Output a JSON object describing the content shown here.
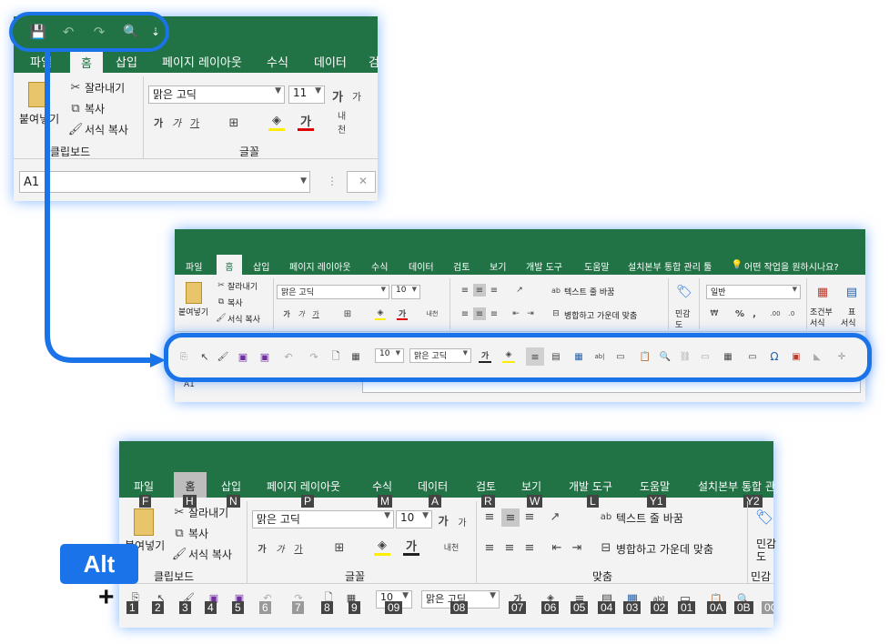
{
  "panel1": {
    "qat_icons": [
      "save-icon",
      "undo-icon",
      "redo-icon",
      "print-preview-icon",
      "more-icon"
    ],
    "tabs": [
      "파일",
      "홈",
      "삽입",
      "페이지 레이아웃",
      "수식",
      "데이터",
      "검"
    ],
    "paste_label": "붙여넣기",
    "cut_label": "잘라내기",
    "copy_label": "복사",
    "format_painter_label": "서식 복사",
    "clipboard_group": "클립보드",
    "font_name": "맑은 고딕",
    "font_size": "11",
    "font_group": "글꼴",
    "name_box": "A1"
  },
  "panel2": {
    "tabs": [
      "파일",
      "홈",
      "삽입",
      "페이지 레이아웃",
      "수식",
      "데이터",
      "검토",
      "보기",
      "개발 도구",
      "도움말",
      "설치본부 통합 관리 툴"
    ],
    "tell_me": "어떤 작업을 원하시나요?",
    "paste_label": "붙여넣기",
    "cut_label": "잘라내기",
    "copy_label": "복사",
    "format_painter_label": "서식 복사",
    "font_name": "맑은 고딕",
    "font_size": "10",
    "wrap_text": "텍스트 줄 바꿈",
    "merge_center": "병합하고 가운데 맞춤",
    "sensitivity_1": "민감",
    "sensitivity_2": "도",
    "number_format": "일반",
    "cond_format_1": "조건부",
    "cond_format_2": "서식",
    "table_1": "표",
    "table_2": "서식",
    "qat_font_size": "10",
    "qat_font_name": "맑은 고딕",
    "name_box": "A1"
  },
  "panel3": {
    "tabs": [
      "파일",
      "홈",
      "삽입",
      "페이지 레이아웃",
      "수식",
      "데이터",
      "검토",
      "보기",
      "개발 도구",
      "도움말",
      "설치본부 통합 관"
    ],
    "tab_keys": [
      "F",
      "H",
      "N",
      "P",
      "M",
      "A",
      "R",
      "W",
      "L",
      "Y1",
      "Y2"
    ],
    "paste_label": "붙여넣기",
    "cut_label": "잘라내기",
    "copy_label": "복사",
    "format_painter_label": "서식 복사",
    "clipboard_group": "클립보드",
    "font_name": "맑은 고딕",
    "font_size": "10",
    "font_group": "글꼴",
    "wrap_text": "텍스트 줄 바꿈",
    "merge_center": "병합하고 가운데 맞춤",
    "align_group": "맞춤",
    "sensitivity_1": "민감",
    "sensitivity_2": "도",
    "sensitivity_group": "민감",
    "qat_keys": [
      "1",
      "2",
      "3",
      "4",
      "5",
      "6",
      "7",
      "8",
      "9",
      "09",
      "08",
      "07",
      "06",
      "05",
      "04",
      "03",
      "02",
      "01",
      "0A",
      "0B",
      "0C"
    ],
    "qat_font_size": "10",
    "qat_font_name": "맑은 고딕"
  },
  "alt_badge": "Alt",
  "plus_sign": "+",
  "colors": {
    "excel_green": "#217346",
    "highlight_blue": "#1a73e8",
    "ribbon_bg": "#f3f3f3"
  }
}
